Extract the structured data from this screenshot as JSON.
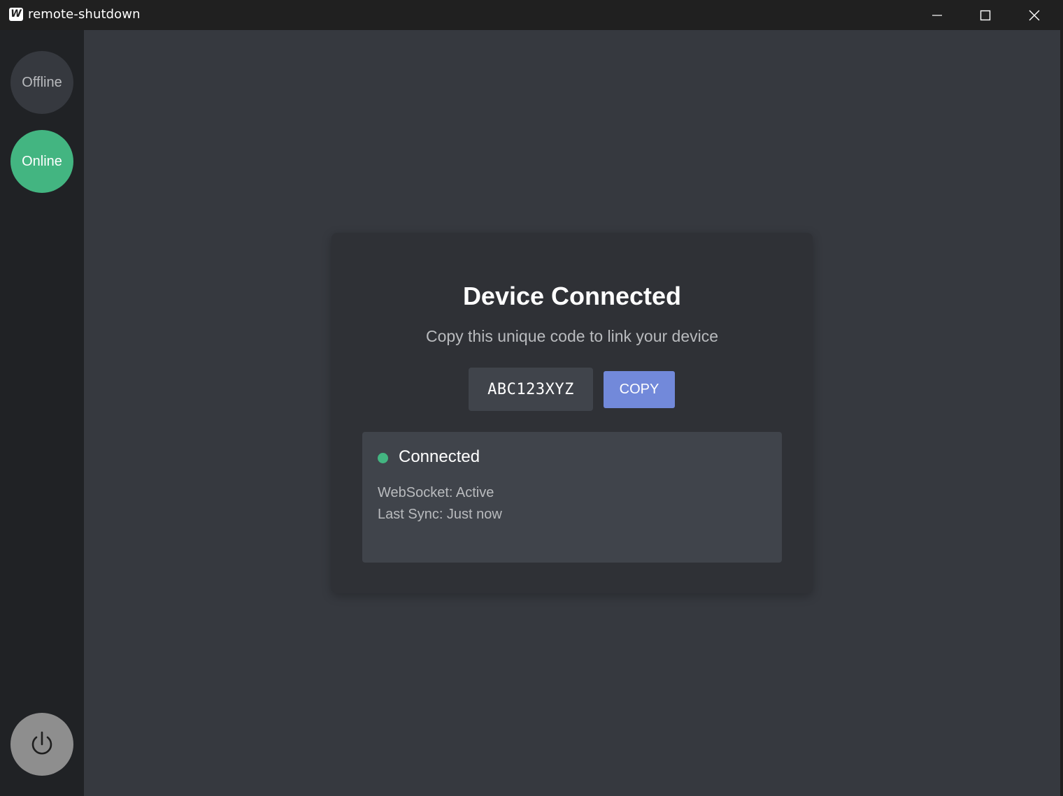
{
  "window": {
    "title": "remote-shutdown",
    "app_icon_letter": "W"
  },
  "sidebar": {
    "offline_label": "Offline",
    "online_label": "Online",
    "online_color": "#43b581",
    "power_icon": "power-icon"
  },
  "card": {
    "title": "Device Connected",
    "subtitle": "Copy this unique code to link your device",
    "code": "ABC123XYZ",
    "copy_label": "COPY",
    "accent_color": "#7289da"
  },
  "status": {
    "label": "Connected",
    "indicator_color": "#43b581",
    "websocket": "WebSocket: Active",
    "last_sync": "Last Sync: Just now"
  }
}
